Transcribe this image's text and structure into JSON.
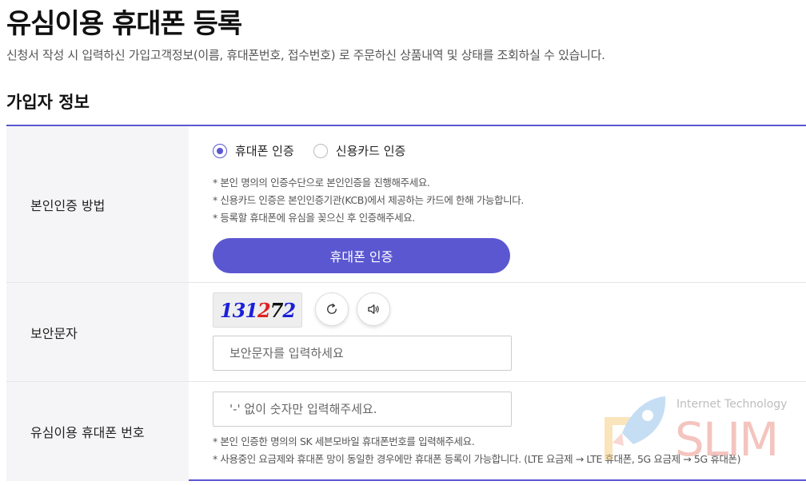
{
  "page": {
    "title": "유심이용 휴대폰 등록",
    "subtitle": "신청서 작성 시 입력하신 가입고객정보(이름, 휴대폰번호, 접수번호) 로 주문하신 상품내역 및 상태를 조회하실 수 있습니다."
  },
  "section": {
    "title": "가입자 정보"
  },
  "auth_row": {
    "label": "본인인증 방법",
    "options": [
      {
        "label": "휴대폰 인증",
        "selected": true
      },
      {
        "label": "신용카드 인증",
        "selected": false
      }
    ],
    "notes": [
      "* 본인 명의의 인증수단으로 본인인증을 진행해주세요.",
      "* 신용카드 인증은 본인인증기관(KCB)에서 제공하는 카드에 한해 가능합니다.",
      "* 등록할 휴대폰에 유심을 꽂으신 후 인증해주세요."
    ],
    "button_label": "휴대폰 인증"
  },
  "captcha_row": {
    "label": "보안문자",
    "captcha_digits": [
      "1",
      "3",
      "1",
      "2",
      "7",
      "2"
    ],
    "refresh_icon": "refresh-icon",
    "audio_icon": "speaker-icon",
    "input_placeholder": "보안문자를 입력하세요"
  },
  "phone_row": {
    "label": "유심이용 휴대폰 번호",
    "input_placeholder": "'-' 없이 숫자만 입력해주세요.",
    "notes": [
      "* 본인 인증한 명의의 SK 세븐모바일 휴대폰번호를 입력해주세요.",
      "* 사용중인 요금제와 휴대폰 망이 동일한 경우에만 휴대폰 등록이 가능합니다. (LTE 요금제 → LTE 휴대폰, 5G 요금제 → 5G 휴대폰)"
    ]
  },
  "watermark": {
    "line1": "Internet Technology",
    "line2": "SLIM"
  },
  "colors": {
    "accent": "#5b57d1",
    "label_bg": "#f5f5f7",
    "captcha_blue": "#1b1fd9",
    "captcha_red": "#e02020"
  }
}
